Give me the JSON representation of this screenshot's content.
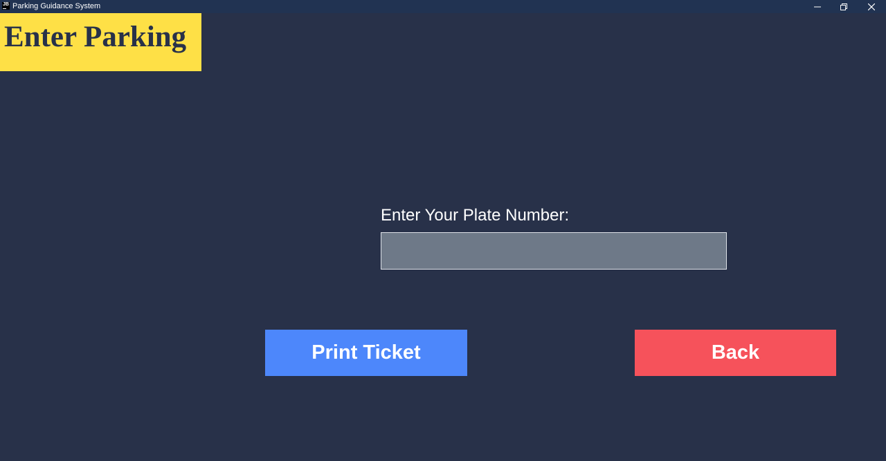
{
  "window": {
    "title": "Parking Guidance System",
    "icon_text": "JB",
    "controls": {
      "minimize": "minimize-icon",
      "maximize": "restore-icon",
      "close": "close-icon"
    }
  },
  "header": {
    "title": "Enter Parking"
  },
  "form": {
    "plate_label": "Enter Your Plate Number:",
    "plate_value": ""
  },
  "actions": {
    "print_label": "Print Ticket",
    "back_label": "Back"
  },
  "colors": {
    "background": "#283149",
    "titlebar": "#213352",
    "header_banner": "#fee046",
    "input_fill": "#6e7988",
    "print_button": "#4d87fb",
    "back_button": "#f6525b"
  }
}
